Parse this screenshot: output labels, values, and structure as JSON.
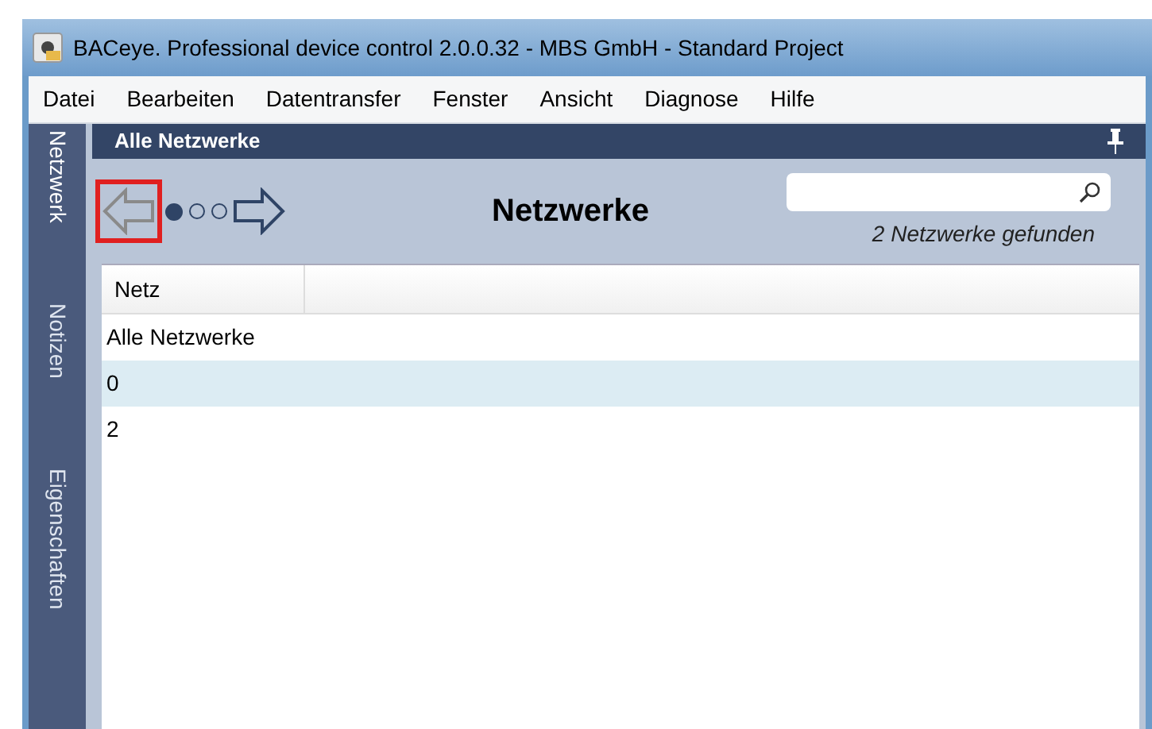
{
  "window": {
    "title": "BACeye. Professional device control 2.0.0.32 - MBS GmbH - Standard Project"
  },
  "menu": [
    "Datei",
    "Bearbeiten",
    "Datentransfer",
    "Fenster",
    "Ansicht",
    "Diagnose",
    "Hilfe"
  ],
  "side_tabs": [
    {
      "label": "Netzwerk",
      "selected": true
    },
    {
      "label": "Notizen",
      "selected": false
    },
    {
      "label": "Eigenschaften",
      "selected": false
    }
  ],
  "panel": {
    "title": "Alle Netzwerke"
  },
  "toolbar": {
    "back_disabled": true,
    "back_highlighted": true,
    "forward_disabled": false,
    "pages": [
      {
        "selected": true
      },
      {
        "selected": false
      },
      {
        "selected": false
      }
    ],
    "heading": "Netzwerke",
    "result_count": "2 Netzwerke gefunden"
  },
  "table": {
    "columns": [
      "Netz"
    ],
    "rows": [
      {
        "cells": [
          "Alle Netzwerke"
        ],
        "highlighted": false
      },
      {
        "cells": [
          "0"
        ],
        "highlighted": true
      },
      {
        "cells": [
          "2"
        ],
        "highlighted": false
      }
    ]
  }
}
